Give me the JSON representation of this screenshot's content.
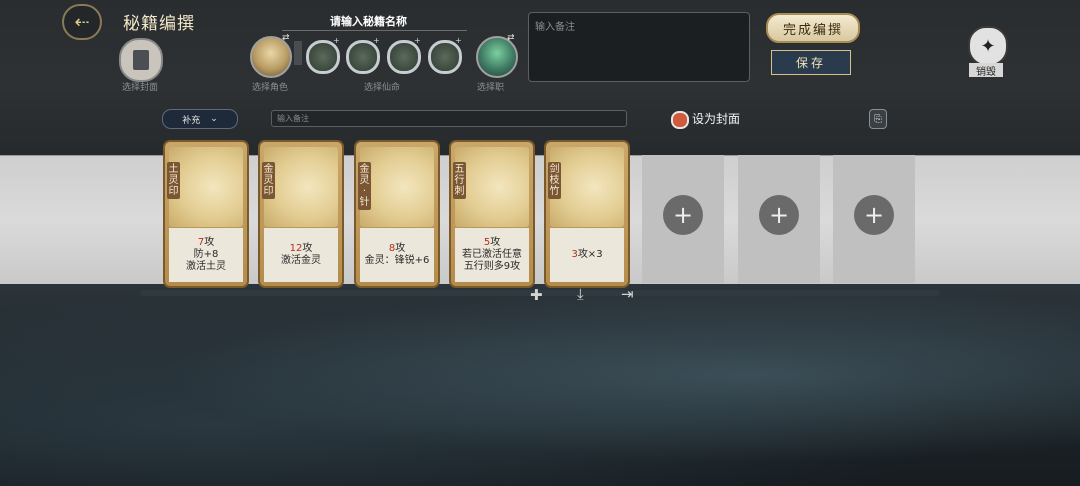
{
  "header": {
    "title": "秘籍编撰",
    "cover_label": "选择封面",
    "name_prompt": "请输入秘籍名称",
    "role_label": "选择角色",
    "fate_label": "选择仙命",
    "job_label": "选择职",
    "note_placeholder": "输入备注",
    "finish_label": "完成编撰",
    "save_label": "保存",
    "destroy_label": "销毁"
  },
  "toolbar": {
    "supplement_label": "补充",
    "small_note_placeholder": "输入备注",
    "set_cover_label": "设为封面"
  },
  "cards": [
    {
      "name": "土灵印",
      "line1_num": "7",
      "line1_text": "攻",
      "line2": "防+8",
      "line3": "激活土灵"
    },
    {
      "name": "金灵印",
      "line1_num": "12",
      "line1_text": "攻",
      "line2": "激活金灵",
      "line3": ""
    },
    {
      "name": "金灵·针",
      "line1_num": "8",
      "line1_text": "攻",
      "line2": "金灵：锋锐+6",
      "line3": ""
    },
    {
      "name": "五行刺",
      "line1_num": "5",
      "line1_text": "攻",
      "line2": "若已激活任意",
      "line3": "五行则多9攻"
    },
    {
      "name": "剑枝竹",
      "line1_num": "3",
      "line1_text": "攻×3",
      "line2": "",
      "line3": ""
    }
  ],
  "colors": {
    "accent_gold": "#c9a76a",
    "highlight_red": "#b0301c",
    "save_blue": "#2a3b4d"
  },
  "icons": {
    "back": "arrow-back-icon",
    "destroy": "destroy-icon",
    "copy": "copy-icon",
    "add_slot": "plus-icon",
    "add_bottom": "plus-icon",
    "download": "download-icon",
    "export": "export-icon"
  }
}
